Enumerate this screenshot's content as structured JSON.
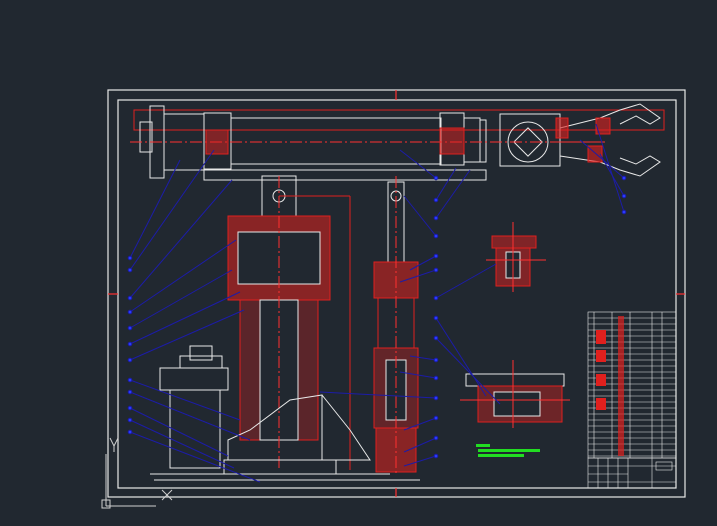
{
  "viewport": {
    "background_color": "#212830"
  },
  "drawing": {
    "palette": {
      "outline": "#e8e8e8",
      "section_hatch": "#e0201e",
      "centerline": "#ff3030",
      "leader_line": "#1c1ca8",
      "leader_dot": "#2a3cff",
      "note_text": "#22dd22",
      "ucs_icon": "#d0d0d0"
    },
    "title_block": {
      "text": ""
    }
  }
}
